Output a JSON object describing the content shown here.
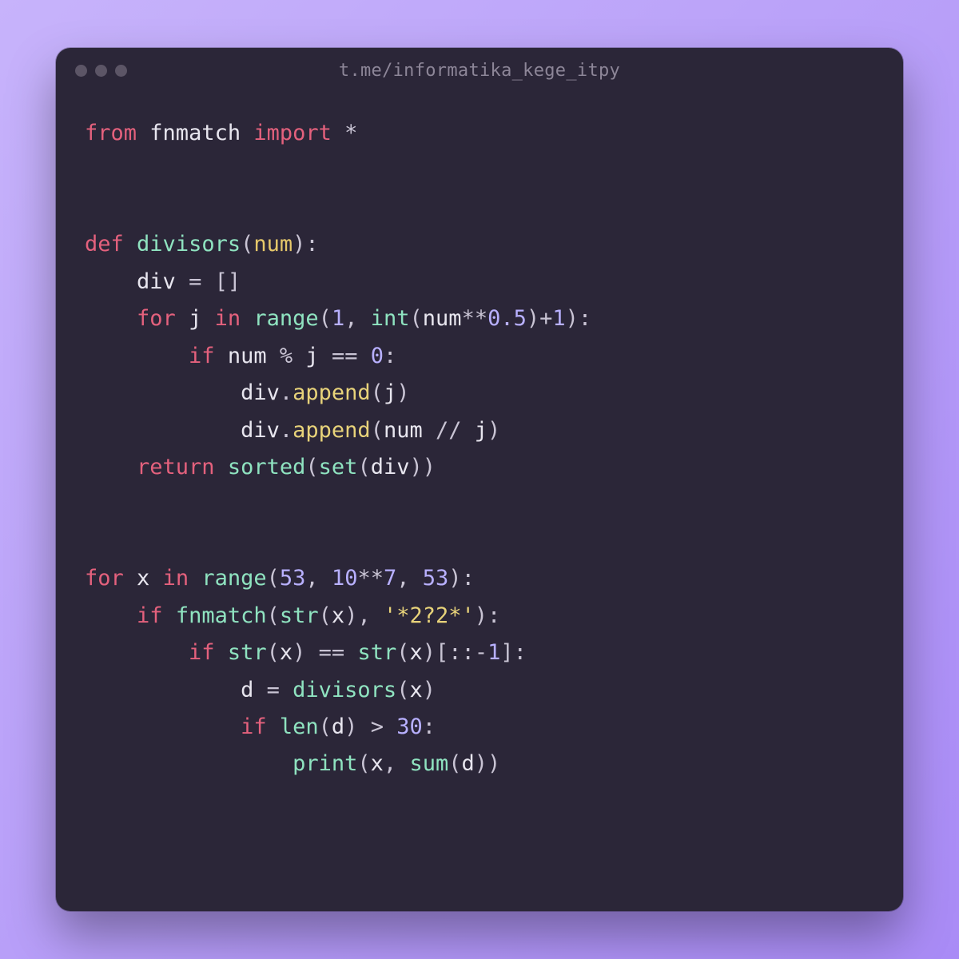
{
  "window": {
    "title": "t.me/informatika_kege_itpy"
  },
  "code": {
    "lines": [
      [
        {
          "t": "from",
          "c": "tok-kw"
        },
        {
          "t": " ",
          "c": "tok-pun"
        },
        {
          "t": "fnmatch",
          "c": "tok-mod"
        },
        {
          "t": " ",
          "c": "tok-pun"
        },
        {
          "t": "import",
          "c": "tok-kw"
        },
        {
          "t": " ",
          "c": "tok-pun"
        },
        {
          "t": "*",
          "c": "tok-op"
        }
      ],
      [],
      [],
      [
        {
          "t": "def",
          "c": "tok-kw"
        },
        {
          "t": " ",
          "c": "tok-pun"
        },
        {
          "t": "divisors",
          "c": "tok-fn"
        },
        {
          "t": "(",
          "c": "tok-pun"
        },
        {
          "t": "num",
          "c": "tok-par"
        },
        {
          "t": ")",
          "c": "tok-pun"
        },
        {
          "t": ":",
          "c": "tok-pun"
        }
      ],
      [
        {
          "t": "    ",
          "c": "tok-pun"
        },
        {
          "t": "div",
          "c": "tok-id"
        },
        {
          "t": " ",
          "c": "tok-pun"
        },
        {
          "t": "=",
          "c": "tok-op"
        },
        {
          "t": " ",
          "c": "tok-pun"
        },
        {
          "t": "[]",
          "c": "tok-pun"
        }
      ],
      [
        {
          "t": "    ",
          "c": "tok-pun"
        },
        {
          "t": "for",
          "c": "tok-kw"
        },
        {
          "t": " ",
          "c": "tok-pun"
        },
        {
          "t": "j",
          "c": "tok-id"
        },
        {
          "t": " ",
          "c": "tok-pun"
        },
        {
          "t": "in",
          "c": "tok-kw"
        },
        {
          "t": " ",
          "c": "tok-pun"
        },
        {
          "t": "range",
          "c": "tok-call"
        },
        {
          "t": "(",
          "c": "tok-pun"
        },
        {
          "t": "1",
          "c": "tok-num"
        },
        {
          "t": ",",
          "c": "tok-pun"
        },
        {
          "t": " ",
          "c": "tok-pun"
        },
        {
          "t": "int",
          "c": "tok-call"
        },
        {
          "t": "(",
          "c": "tok-pun"
        },
        {
          "t": "num",
          "c": "tok-id"
        },
        {
          "t": "**",
          "c": "tok-op"
        },
        {
          "t": "0.5",
          "c": "tok-num"
        },
        {
          "t": ")",
          "c": "tok-pun"
        },
        {
          "t": "+",
          "c": "tok-op"
        },
        {
          "t": "1",
          "c": "tok-num"
        },
        {
          "t": ")",
          "c": "tok-pun"
        },
        {
          "t": ":",
          "c": "tok-pun"
        }
      ],
      [
        {
          "t": "        ",
          "c": "tok-pun"
        },
        {
          "t": "if",
          "c": "tok-kw"
        },
        {
          "t": " ",
          "c": "tok-pun"
        },
        {
          "t": "num",
          "c": "tok-id"
        },
        {
          "t": " ",
          "c": "tok-pun"
        },
        {
          "t": "%",
          "c": "tok-op"
        },
        {
          "t": " ",
          "c": "tok-pun"
        },
        {
          "t": "j",
          "c": "tok-id"
        },
        {
          "t": " ",
          "c": "tok-pun"
        },
        {
          "t": "==",
          "c": "tok-op"
        },
        {
          "t": " ",
          "c": "tok-pun"
        },
        {
          "t": "0",
          "c": "tok-num"
        },
        {
          "t": ":",
          "c": "tok-pun"
        }
      ],
      [
        {
          "t": "            ",
          "c": "tok-pun"
        },
        {
          "t": "div",
          "c": "tok-id"
        },
        {
          "t": ".",
          "c": "tok-pun"
        },
        {
          "t": "append",
          "c": "tok-callY"
        },
        {
          "t": "(",
          "c": "tok-pun"
        },
        {
          "t": "j",
          "c": "tok-id"
        },
        {
          "t": ")",
          "c": "tok-pun"
        }
      ],
      [
        {
          "t": "            ",
          "c": "tok-pun"
        },
        {
          "t": "div",
          "c": "tok-id"
        },
        {
          "t": ".",
          "c": "tok-pun"
        },
        {
          "t": "append",
          "c": "tok-callY"
        },
        {
          "t": "(",
          "c": "tok-pun"
        },
        {
          "t": "num",
          "c": "tok-id"
        },
        {
          "t": " ",
          "c": "tok-pun"
        },
        {
          "t": "//",
          "c": "tok-op"
        },
        {
          "t": " ",
          "c": "tok-pun"
        },
        {
          "t": "j",
          "c": "tok-id"
        },
        {
          "t": ")",
          "c": "tok-pun"
        }
      ],
      [
        {
          "t": "    ",
          "c": "tok-pun"
        },
        {
          "t": "return",
          "c": "tok-kw"
        },
        {
          "t": " ",
          "c": "tok-pun"
        },
        {
          "t": "sorted",
          "c": "tok-call"
        },
        {
          "t": "(",
          "c": "tok-pun"
        },
        {
          "t": "set",
          "c": "tok-call"
        },
        {
          "t": "(",
          "c": "tok-pun"
        },
        {
          "t": "div",
          "c": "tok-id"
        },
        {
          "t": ")",
          "c": "tok-pun"
        },
        {
          "t": ")",
          "c": "tok-pun"
        }
      ],
      [],
      [],
      [
        {
          "t": "for",
          "c": "tok-kw"
        },
        {
          "t": " ",
          "c": "tok-pun"
        },
        {
          "t": "x",
          "c": "tok-id"
        },
        {
          "t": " ",
          "c": "tok-pun"
        },
        {
          "t": "in",
          "c": "tok-kw"
        },
        {
          "t": " ",
          "c": "tok-pun"
        },
        {
          "t": "range",
          "c": "tok-call"
        },
        {
          "t": "(",
          "c": "tok-pun"
        },
        {
          "t": "53",
          "c": "tok-num"
        },
        {
          "t": ",",
          "c": "tok-pun"
        },
        {
          "t": " ",
          "c": "tok-pun"
        },
        {
          "t": "10",
          "c": "tok-num"
        },
        {
          "t": "**",
          "c": "tok-op"
        },
        {
          "t": "7",
          "c": "tok-num"
        },
        {
          "t": ",",
          "c": "tok-pun"
        },
        {
          "t": " ",
          "c": "tok-pun"
        },
        {
          "t": "53",
          "c": "tok-num"
        },
        {
          "t": ")",
          "c": "tok-pun"
        },
        {
          "t": ":",
          "c": "tok-pun"
        }
      ],
      [
        {
          "t": "    ",
          "c": "tok-pun"
        },
        {
          "t": "if",
          "c": "tok-kw"
        },
        {
          "t": " ",
          "c": "tok-pun"
        },
        {
          "t": "fnmatch",
          "c": "tok-call"
        },
        {
          "t": "(",
          "c": "tok-pun"
        },
        {
          "t": "str",
          "c": "tok-call"
        },
        {
          "t": "(",
          "c": "tok-pun"
        },
        {
          "t": "x",
          "c": "tok-id"
        },
        {
          "t": ")",
          "c": "tok-pun"
        },
        {
          "t": ",",
          "c": "tok-pun"
        },
        {
          "t": " ",
          "c": "tok-pun"
        },
        {
          "t": "'*2?2*'",
          "c": "tok-str"
        },
        {
          "t": ")",
          "c": "tok-pun"
        },
        {
          "t": ":",
          "c": "tok-pun"
        }
      ],
      [
        {
          "t": "        ",
          "c": "tok-pun"
        },
        {
          "t": "if",
          "c": "tok-kw"
        },
        {
          "t": " ",
          "c": "tok-pun"
        },
        {
          "t": "str",
          "c": "tok-call"
        },
        {
          "t": "(",
          "c": "tok-pun"
        },
        {
          "t": "x",
          "c": "tok-id"
        },
        {
          "t": ")",
          "c": "tok-pun"
        },
        {
          "t": " ",
          "c": "tok-pun"
        },
        {
          "t": "==",
          "c": "tok-op"
        },
        {
          "t": " ",
          "c": "tok-pun"
        },
        {
          "t": "str",
          "c": "tok-call"
        },
        {
          "t": "(",
          "c": "tok-pun"
        },
        {
          "t": "x",
          "c": "tok-id"
        },
        {
          "t": ")",
          "c": "tok-pun"
        },
        {
          "t": "[",
          "c": "tok-pun"
        },
        {
          "t": "::",
          "c": "tok-op"
        },
        {
          "t": "-",
          "c": "tok-op"
        },
        {
          "t": "1",
          "c": "tok-num"
        },
        {
          "t": "]",
          "c": "tok-pun"
        },
        {
          "t": ":",
          "c": "tok-pun"
        }
      ],
      [
        {
          "t": "            ",
          "c": "tok-pun"
        },
        {
          "t": "d",
          "c": "tok-id"
        },
        {
          "t": " ",
          "c": "tok-pun"
        },
        {
          "t": "=",
          "c": "tok-op"
        },
        {
          "t": " ",
          "c": "tok-pun"
        },
        {
          "t": "divisors",
          "c": "tok-call"
        },
        {
          "t": "(",
          "c": "tok-pun"
        },
        {
          "t": "x",
          "c": "tok-id"
        },
        {
          "t": ")",
          "c": "tok-pun"
        }
      ],
      [
        {
          "t": "            ",
          "c": "tok-pun"
        },
        {
          "t": "if",
          "c": "tok-kw"
        },
        {
          "t": " ",
          "c": "tok-pun"
        },
        {
          "t": "len",
          "c": "tok-call"
        },
        {
          "t": "(",
          "c": "tok-pun"
        },
        {
          "t": "d",
          "c": "tok-id"
        },
        {
          "t": ")",
          "c": "tok-pun"
        },
        {
          "t": " ",
          "c": "tok-pun"
        },
        {
          "t": ">",
          "c": "tok-op"
        },
        {
          "t": " ",
          "c": "tok-pun"
        },
        {
          "t": "30",
          "c": "tok-num"
        },
        {
          "t": ":",
          "c": "tok-pun"
        }
      ],
      [
        {
          "t": "                ",
          "c": "tok-pun"
        },
        {
          "t": "print",
          "c": "tok-call"
        },
        {
          "t": "(",
          "c": "tok-pun"
        },
        {
          "t": "x",
          "c": "tok-id"
        },
        {
          "t": ",",
          "c": "tok-pun"
        },
        {
          "t": " ",
          "c": "tok-pun"
        },
        {
          "t": "sum",
          "c": "tok-call"
        },
        {
          "t": "(",
          "c": "tok-pun"
        },
        {
          "t": "d",
          "c": "tok-id"
        },
        {
          "t": ")",
          "c": "tok-pun"
        },
        {
          "t": ")",
          "c": "tok-pun"
        }
      ]
    ]
  }
}
